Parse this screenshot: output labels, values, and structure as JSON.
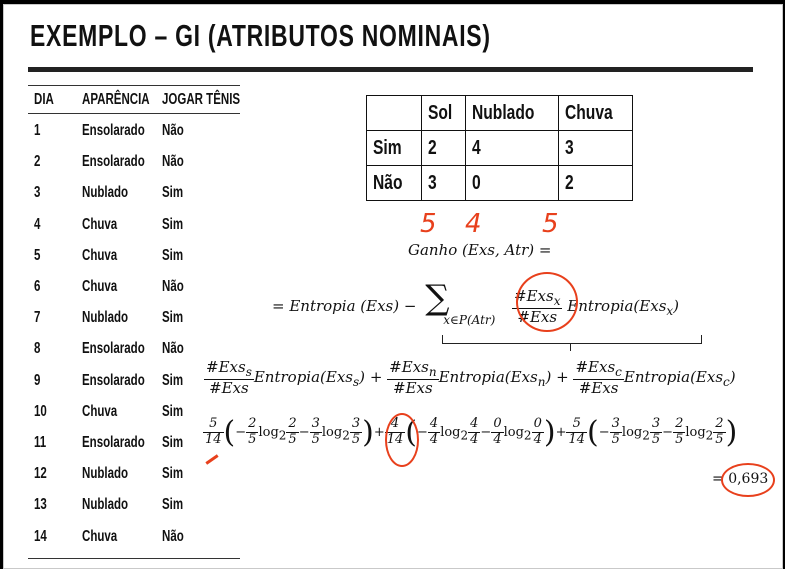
{
  "title": "EXEMPLO – GI (ATRIBUTOS NOMINAIS)",
  "days_table": {
    "headers": [
      "DIA",
      "APARÊNCIA",
      "JOGAR TÊNIS"
    ],
    "rows": [
      [
        "1",
        "Ensolarado",
        "Não"
      ],
      [
        "2",
        "Ensolarado",
        "Não"
      ],
      [
        "3",
        "Nublado",
        "Sim"
      ],
      [
        "4",
        "Chuva",
        "Sim"
      ],
      [
        "5",
        "Chuva",
        "Sim"
      ],
      [
        "6",
        "Chuva",
        "Não"
      ],
      [
        "7",
        "Nublado",
        "Sim"
      ],
      [
        "8",
        "Ensolarado",
        "Não"
      ],
      [
        "9",
        "Ensolarado",
        "Sim"
      ],
      [
        "10",
        "Chuva",
        "Sim"
      ],
      [
        "11",
        "Ensolarado",
        "Sim"
      ],
      [
        "12",
        "Nublado",
        "Sim"
      ],
      [
        "13",
        "Nublado",
        "Sim"
      ],
      [
        "14",
        "Chuva",
        "Não"
      ]
    ]
  },
  "counts_table": {
    "headers": [
      "",
      "Sol",
      "Nublado",
      "Chuva"
    ],
    "rows": [
      [
        "Sim",
        "2",
        "4",
        "3"
      ],
      [
        "Não",
        "3",
        "0",
        "2"
      ]
    ],
    "handwritten_totals": [
      "5",
      "4",
      "5"
    ]
  },
  "formulas": {
    "gain_label": "Ganho (Exs, Atr) =",
    "entropy_eq": "= Entropia (Exs) −",
    "sum_sub": "x∈P(Atr)",
    "frac_num": "#Exs",
    "frac_num_sub": "x",
    "frac_den": "#Exs",
    "entropy_x": "Entropia(Exs",
    "entropy_x_sub": "x",
    "close": ")",
    "term_s_sub": "s",
    "term_n_sub": "n",
    "term_c_sub": "c",
    "entropy_word": "Entropia(Exs",
    "plus": "+",
    "result_prefix": "=",
    "result": "0,693"
  },
  "colors": {
    "annotation": "#e8401c",
    "text": "#111111",
    "frame": "#000000"
  }
}
